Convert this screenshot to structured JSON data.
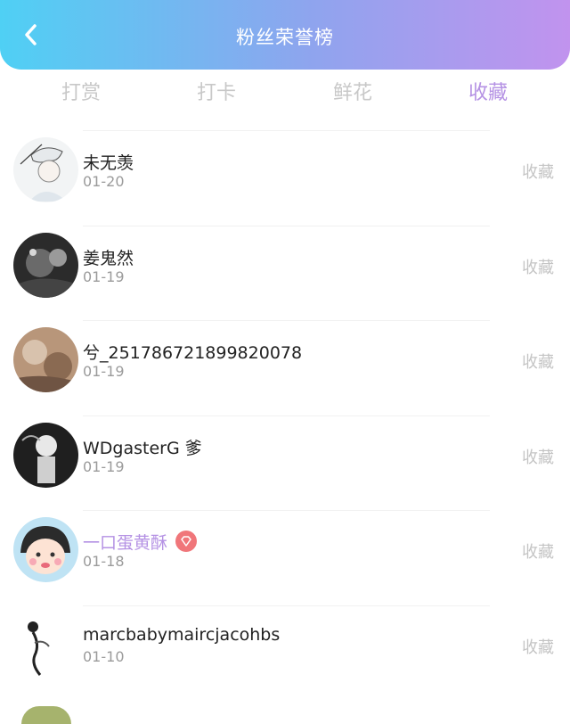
{
  "header": {
    "title": "粉丝荣誉榜",
    "back_icon": "chevron-left-icon"
  },
  "tabs": [
    {
      "label": "打赏",
      "active": false
    },
    {
      "label": "打卡",
      "active": false
    },
    {
      "label": "鲜花",
      "active": false
    },
    {
      "label": "收藏",
      "active": true
    }
  ],
  "colors": {
    "header_start": "#4fd0f4",
    "header_end": "#c193ee",
    "accent": "#b592e4",
    "badge": "#f0767a"
  },
  "rows": [
    {
      "name": "未无羡",
      "date": "01-20",
      "action": "收藏",
      "vip": false
    },
    {
      "name": "姜鬼然",
      "date": "01-19",
      "action": "收藏",
      "vip": false
    },
    {
      "name": "兮_2517867218998200​78",
      "date": "01-19",
      "action": "收藏",
      "vip": false
    },
    {
      "name": "WDgasterG 爹",
      "date": "01-19",
      "action": "收藏",
      "vip": false
    },
    {
      "name": "一口蛋黄酥",
      "date": "01-18",
      "action": "收藏",
      "vip": true,
      "badge_icon": "diamond-badge-icon"
    },
    {
      "name": "marcbabymaircjacohbs",
      "date": "01-10",
      "action": "收藏",
      "vip": false
    }
  ]
}
